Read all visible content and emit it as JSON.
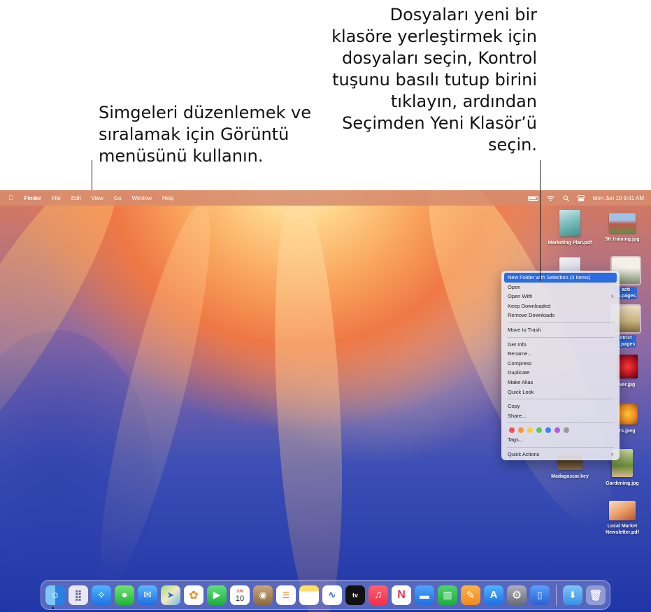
{
  "callouts": {
    "left": "Simgeleri düzenlemek ve sıralamak için Görüntü menüsünü kullanın.",
    "right": "Dosyaları yeni bir klasöre yerleştirmek için dosyaları seçin, Kontrol tuşunu basılı tutup birini tıklayın, ardından Seçimden Yeni Klasör’ü seçin."
  },
  "menubar": {
    "app": "Finder",
    "menus": [
      "File",
      "Edit",
      "View",
      "Go",
      "Window",
      "Help"
    ],
    "datetime": "Mon Jun 10  9:41 AM"
  },
  "desktop_icons": [
    {
      "label": "Marketing Plan.pdf",
      "selected": false
    },
    {
      "label": "5K training.jpg",
      "selected": false
    },
    {
      "label": "acti\n.n.pages",
      "selected": true
    },
    {
      "label": "strict\n.t.pages",
      "selected": true
    },
    {
      "label": "ver.jpg",
      "selected": false
    },
    {
      "label": "rs.jpeg",
      "selected": false
    },
    {
      "label": "Madagascar.key",
      "selected": false
    },
    {
      "label": "Gardening.jpg",
      "selected": false
    },
    {
      "label": "Local Market\nNewsletter.pdf",
      "selected": false
    }
  ],
  "context_menu": {
    "items": [
      "New Folder with Selection (3 Items)",
      "Open",
      "Open With",
      "Keep Downloaded",
      "Remove Downloads",
      "Move to Trash",
      "Get Info",
      "Rename...",
      "Compress",
      "Duplicate",
      "Make Alias",
      "Quick Look",
      "Copy",
      "Share...",
      "Tags...",
      "Quick Actions"
    ],
    "tag_colors": [
      "#f0515b",
      "#f4983b",
      "#f6cf3c",
      "#5bc95b",
      "#3b82f0",
      "#a95fe0",
      "#9a9a9a"
    ]
  },
  "dock": {
    "calendar_month": "JUN",
    "calendar_day": "10",
    "tv_label": "tv"
  }
}
